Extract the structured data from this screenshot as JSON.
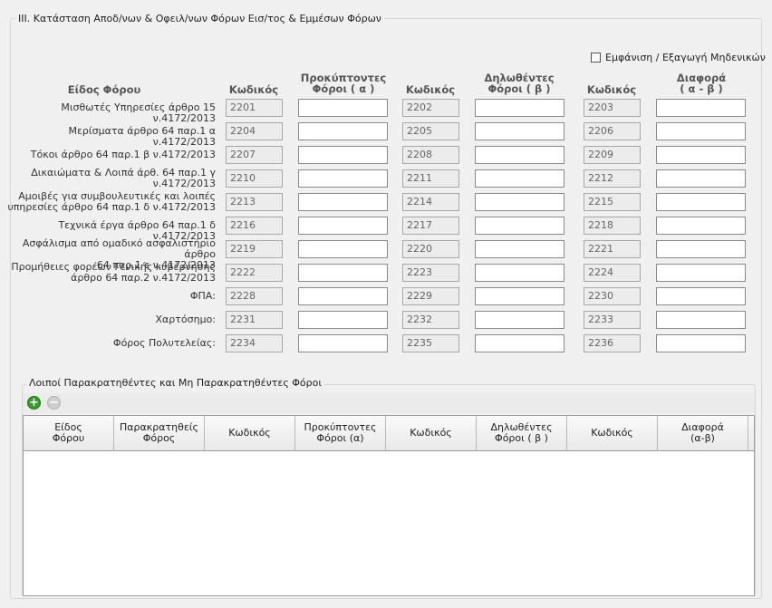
{
  "section_title": "III. Κατάσταση Αποδ/νων & Οφειλ/νων Φόρων Εισ/τος & Εμμέσων Φόρων",
  "zero_toggle_label": "Εμφάνιση / Εξαγωγή Μηδενικών",
  "headers": {
    "tax_type": "Είδος Φόρου",
    "code1": "Κωδικός",
    "accrued_1": "Προκύπτοντες",
    "accrued_2": "Φόροι ( α )",
    "code2": "Κωδικός",
    "declared_1": "Δηλωθέντες",
    "declared_2": "Φόροι ( β )",
    "code3": "Κωδικός",
    "diff_1": "Διαφορά",
    "diff_2": "( α - β )"
  },
  "rows": [
    {
      "l1": "Μισθωτές Υπηρεσίες άρθρο 15 ν.4172/2013",
      "l2": "",
      "c1": "2201",
      "c2": "2202",
      "c3": "2203"
    },
    {
      "l1": "Μερίσματα άρθρο 64 παρ.1 α ν.4172/2013",
      "l2": "",
      "c1": "2204",
      "c2": "2205",
      "c3": "2206"
    },
    {
      "l1": "Τόκοι άρθρο 64 παρ.1 β ν.4172/2013",
      "l2": "",
      "c1": "2207",
      "c2": "2208",
      "c3": "2209"
    },
    {
      "l1": "Δικαιώματα & Λοιπά άρθ. 64 παρ.1 γ",
      "l2": "ν.4172/2013",
      "c1": "2210",
      "c2": "2211",
      "c3": "2212"
    },
    {
      "l1": "Αμοιβές για συμβουλευτικές και λοιπές",
      "l2": "υπηρεσίες άρθρο 64 παρ.1 δ ν.4172/2013",
      "c1": "2213",
      "c2": "2214",
      "c3": "2215"
    },
    {
      "l1": "Τεχνικά έργα άρθρο 64 παρ.1 δ ν.4172/2013",
      "l2": "",
      "c1": "2216",
      "c2": "2217",
      "c3": "2218"
    },
    {
      "l1": "Ασφάλισμα από ομαδικό ασφαλιστήριο άρθρο",
      "l2": "64 παρ.1 ε ν.4172/2013",
      "c1": "2219",
      "c2": "2220",
      "c3": "2221"
    },
    {
      "l1": "Προμήθειες φορέων Γενικής κυβέρνησης",
      "l2": "άρθρο 64 παρ.2 ν.4172/2013",
      "c1": "2222",
      "c2": "2223",
      "c3": "2224"
    },
    {
      "l1": "ΦΠΑ:",
      "l2": "",
      "c1": "2228",
      "c2": "2229",
      "c3": "2230"
    },
    {
      "l1": "Χαρτόσημο:",
      "l2": "",
      "c1": "2231",
      "c2": "2232",
      "c3": "2233"
    },
    {
      "l1": "Φόρος Πολυτελείας:",
      "l2": "",
      "c1": "2234",
      "c2": "2235",
      "c3": "2236"
    }
  ],
  "subsection_title": "Λοιποί Παρακρατηθέντες και Μη Παρακρατηθέντες Φόροι",
  "toolbar": {
    "add_icon": "plus-circle-icon",
    "remove_icon": "minus-circle-icon"
  },
  "grid_columns": [
    {
      "l1": "Είδος",
      "l2": "Φόρου"
    },
    {
      "l1": "Παρακρατηθείς",
      "l2": "Φόρος"
    },
    {
      "l1": "Κωδικός",
      "l2": ""
    },
    {
      "l1": "Προκύπτοντες",
      "l2": "Φόροι (α)"
    },
    {
      "l1": "Κωδικός",
      "l2": ""
    },
    {
      "l1": "Δηλωθέντες",
      "l2": "Φόροι ( β )"
    },
    {
      "l1": "Κωδικός",
      "l2": ""
    },
    {
      "l1": "Διαφορά",
      "l2": "(α-β)"
    }
  ],
  "colors": {
    "add_button": "#3a9a2e",
    "background": "#f0f0f0"
  }
}
